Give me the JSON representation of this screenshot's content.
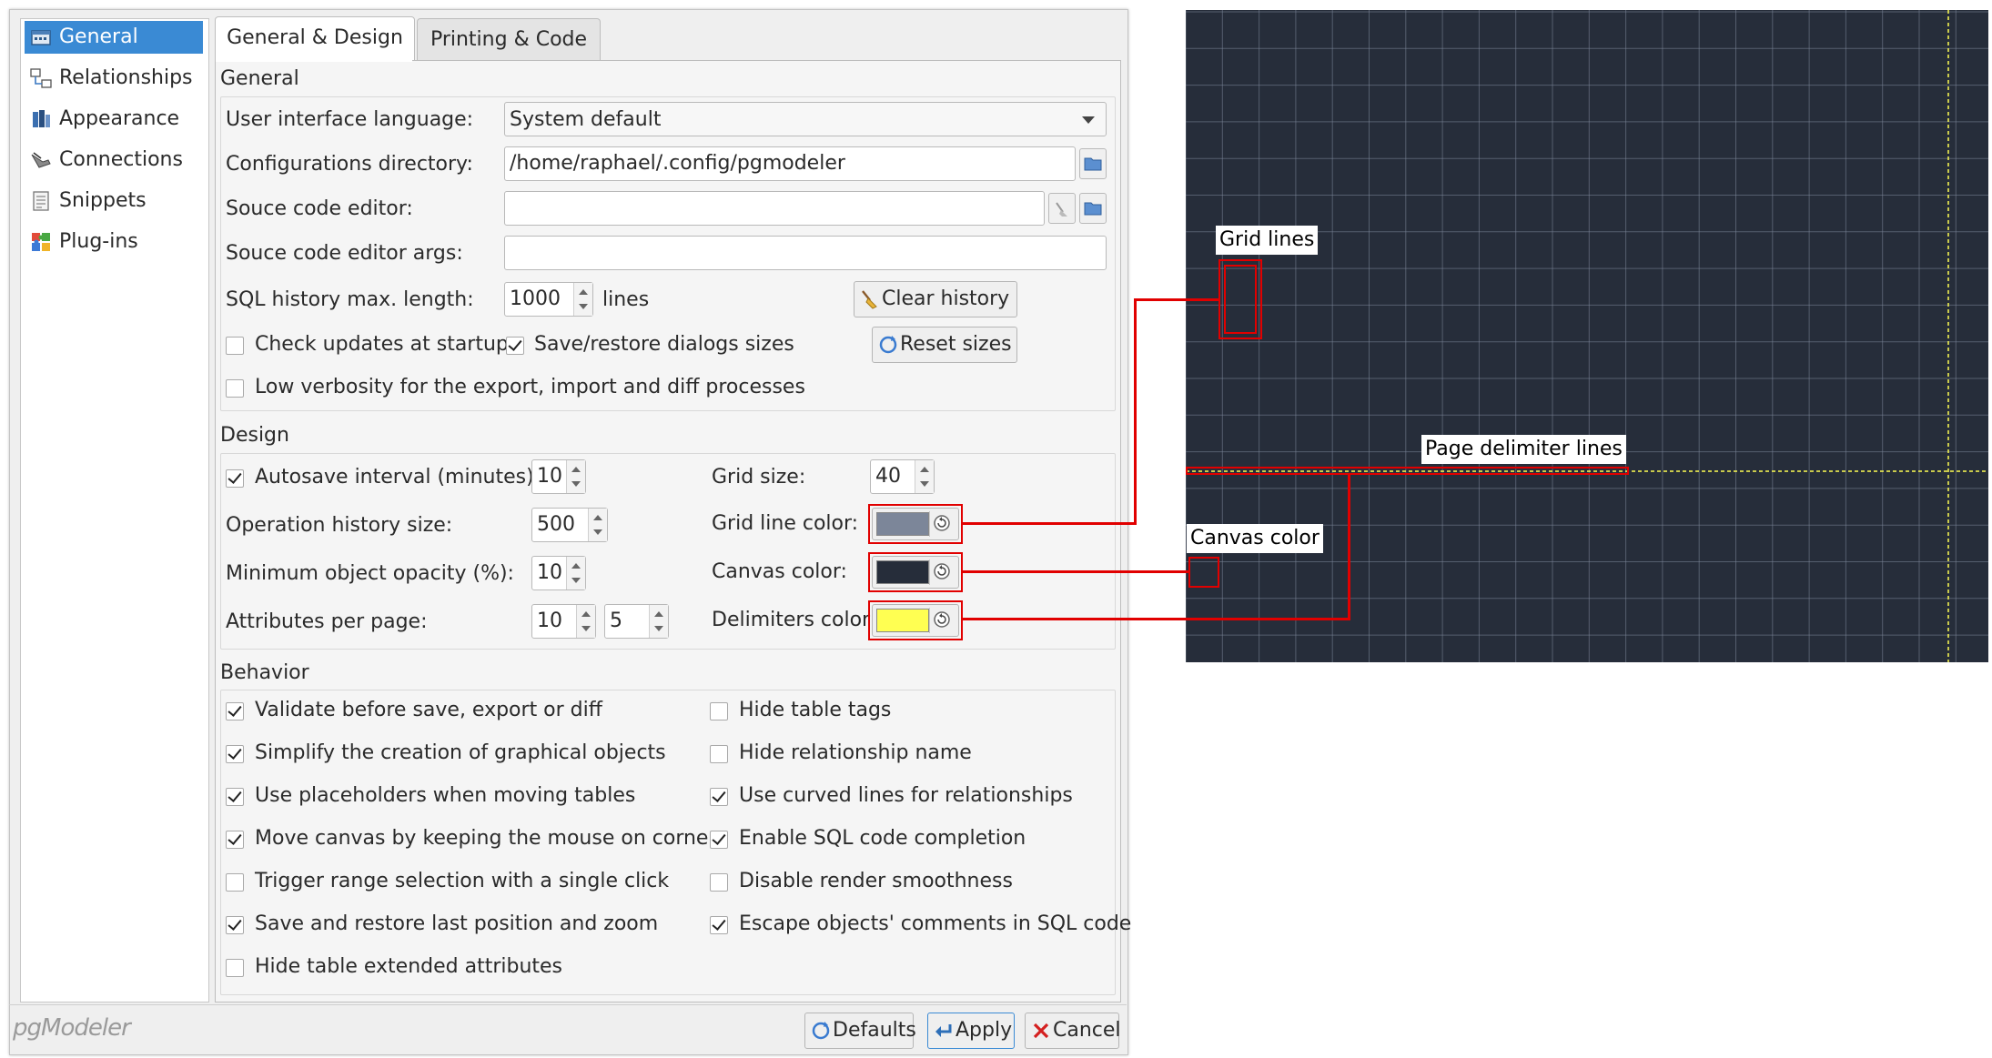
{
  "sidebar": {
    "items": [
      {
        "label": "General",
        "icon": "general-settings-icon",
        "selected": true
      },
      {
        "label": "Relationships",
        "icon": "relationships-icon",
        "selected": false
      },
      {
        "label": "Appearance",
        "icon": "appearance-icon",
        "selected": false
      },
      {
        "label": "Connections",
        "icon": "connections-icon",
        "selected": false
      },
      {
        "label": "Snippets",
        "icon": "snippets-icon",
        "selected": false
      },
      {
        "label": "Plug-ins",
        "icon": "plugins-icon",
        "selected": false
      }
    ]
  },
  "tabs": [
    {
      "label": "General & Design",
      "active": true
    },
    {
      "label": "Printing & Code",
      "active": false
    }
  ],
  "general": {
    "title": "General",
    "ui_language_label": "User interface language:",
    "ui_language_value": "System default",
    "config_dir_label": "Configurations directory:",
    "config_dir_value": "/home/raphael/.config/pgmodeler",
    "source_editor_label": "Souce code editor:",
    "source_editor_value": "",
    "source_editor_args_label": "Souce code editor args:",
    "source_editor_args_value": "",
    "sql_history_label": "SQL history max. length:",
    "sql_history_value": "1000",
    "sql_history_unit": "lines",
    "clear_history_label": "Clear history",
    "reset_sizes_label": "Reset sizes",
    "check_updates_label": "Check updates at startup",
    "check_updates_checked": false,
    "save_dialogs_label": "Save/restore dialogs sizes",
    "save_dialogs_checked": true,
    "low_verbosity_label": "Low verbosity for the export, import and diff processes",
    "low_verbosity_checked": false
  },
  "design": {
    "title": "Design",
    "autosave_label": "Autosave interval (minutes):",
    "autosave_checked": true,
    "autosave_value": "10",
    "op_history_label": "Operation history size:",
    "op_history_value": "500",
    "min_opacity_label": "Minimum object opacity (%):",
    "min_opacity_value": "10",
    "attrs_per_page_label": "Attributes per page:",
    "attrs_per_page_value1": "10",
    "attrs_per_page_value2": "5",
    "grid_size_label": "Grid size:",
    "grid_size_value": "40",
    "grid_line_color_label": "Grid line color:",
    "grid_line_color": "#7c8699",
    "canvas_color_label": "Canvas color:",
    "canvas_color": "#262d3a",
    "delimiters_color_label": "Delimiters color:",
    "delimiters_color": "#ffff52"
  },
  "behavior": {
    "title": "Behavior",
    "left": [
      {
        "label": "Validate before save, export or diff",
        "checked": true
      },
      {
        "label": "Simplify the creation of graphical objects",
        "checked": true
      },
      {
        "label": "Use placeholders when moving tables",
        "checked": true
      },
      {
        "label": "Move canvas by keeping the mouse on corners",
        "checked": true
      },
      {
        "label": "Trigger range selection with a single click",
        "checked": false
      },
      {
        "label": "Save and restore last position and zoom",
        "checked": true
      },
      {
        "label": "Hide table extended attributes",
        "checked": false
      }
    ],
    "right": [
      {
        "label": "Hide table tags",
        "checked": false
      },
      {
        "label": "Hide relationship name",
        "checked": false
      },
      {
        "label": "Use curved lines for relationships",
        "checked": true
      },
      {
        "label": "Enable SQL code completion",
        "checked": true
      },
      {
        "label": "Disable render smoothness",
        "checked": false
      },
      {
        "label": "Escape objects' comments in SQL code",
        "checked": true
      }
    ]
  },
  "footer": {
    "logo": "pgModeler",
    "defaults_label": "Defaults",
    "apply_label": "Apply",
    "cancel_label": "Cancel"
  },
  "preview": {
    "grid_lines_label": "Grid lines",
    "page_delimiter_label": "Page delimiter lines",
    "canvas_color_label": "Canvas color",
    "accent_color": "#e10000"
  }
}
